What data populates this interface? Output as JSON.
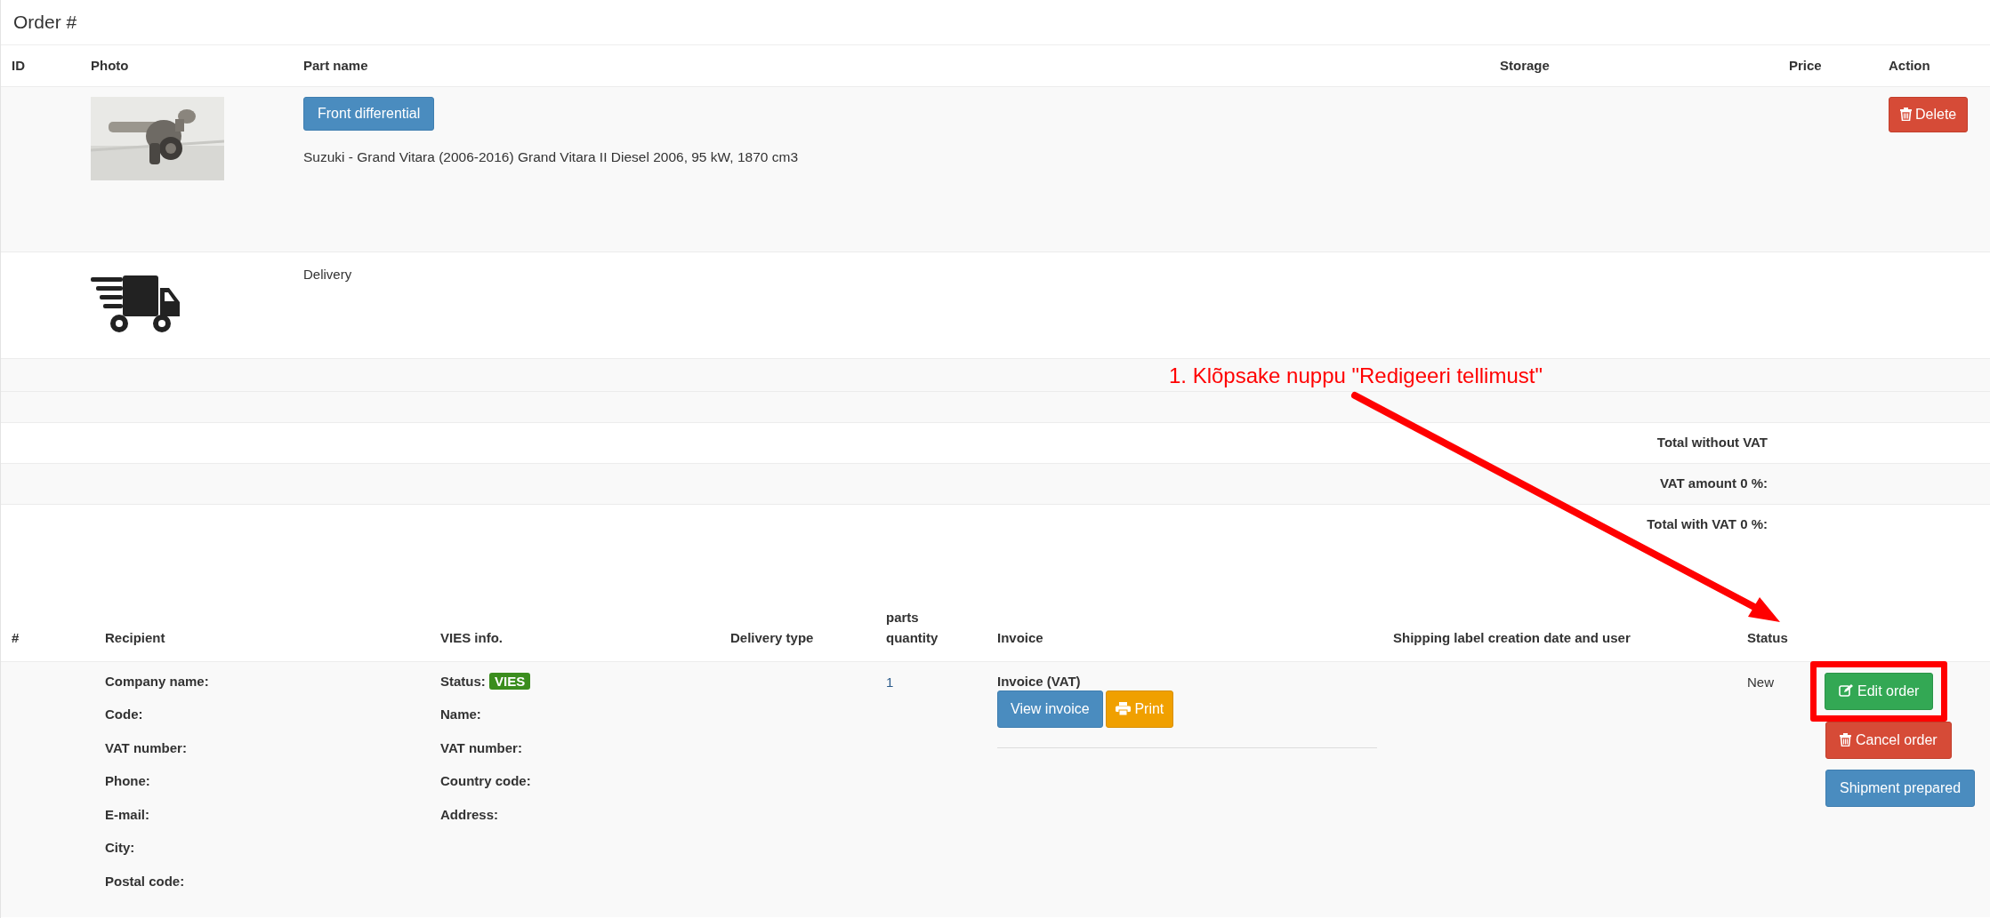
{
  "title": "Order #",
  "items_table": {
    "columns": [
      "ID",
      "Photo",
      "Part name",
      "Storage",
      "Price",
      "Action"
    ],
    "rows": [
      {
        "kind": "part",
        "part_button": "Front differential",
        "description": "Suzuki - Grand Vitara (2006-2016) Grand Vitara II Diesel 2006, 95 kW, 1870 cm3",
        "action": "Delete"
      },
      {
        "kind": "delivery",
        "label": "Delivery"
      }
    ],
    "totals": [
      "Total without VAT",
      "VAT amount 0 %:",
      "Total with VAT 0 %:"
    ]
  },
  "annotation": {
    "text": "1. Klõpsake nuppu \"Redigeeri tellimust\""
  },
  "orders_table": {
    "columns": [
      "#",
      "Recipient",
      "VIES info.",
      "Delivery type",
      "parts quantity",
      "Invoice",
      "Shipping label creation date and user",
      "Status"
    ],
    "recipient_fields": [
      "Company name:",
      "Code:",
      "VAT number:",
      "Phone:",
      "E-mail:",
      "City:",
      "Postal code:"
    ],
    "vies": {
      "status_label": "Status:",
      "badge": "VIES",
      "fields": [
        "Name:",
        "VAT number:",
        "Country code:",
        "Address:"
      ]
    },
    "quantity": "1",
    "invoice": {
      "title": "Invoice (VAT)",
      "buttons": [
        {
          "kind": "view",
          "label": "View invoice"
        },
        {
          "kind": "print",
          "label": "Print"
        }
      ]
    },
    "status": "New",
    "actions": [
      {
        "kind": "edit",
        "label": "Edit order",
        "highlighted": true
      },
      {
        "kind": "cancel",
        "label": "Cancel order",
        "highlighted": false
      },
      {
        "kind": "shipment",
        "label": "Shipment prepared",
        "highlighted": false
      }
    ]
  }
}
